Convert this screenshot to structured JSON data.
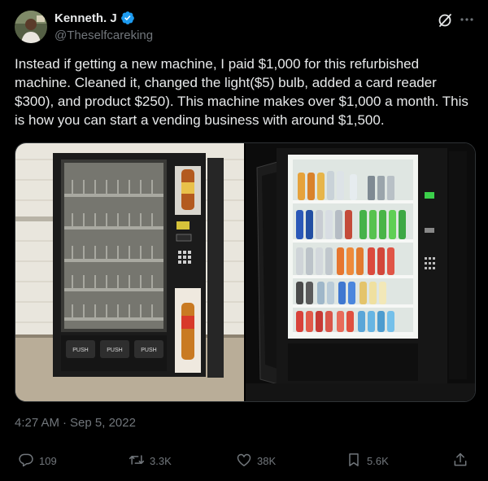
{
  "author": {
    "display_name": "Kenneth. J",
    "handle": "@Theselfcareking",
    "verified": true
  },
  "icons": {
    "avatar": "user-avatar",
    "verified": "verified-badge-icon",
    "grok": "grok-icon",
    "more": "more-icon",
    "reply": "reply-icon",
    "retweet": "retweet-icon",
    "like": "like-icon",
    "bookmark": "bookmark-icon",
    "share": "share-icon"
  },
  "tweet": {
    "text": "Instead if getting a new machine, I paid $1,000 for this refurbished machine. Cleaned it, changed the light($5) bulb, added a card reader $300), and product $250). This machine makes over $1,000 a month. This is how you can start a vending business with around $1,500."
  },
  "media": {
    "left_push_labels": [
      "PUSH",
      "PUSH",
      "PUSH"
    ]
  },
  "meta": {
    "time": "4:27 AM",
    "separator": "·",
    "date": "Sep 5, 2022"
  },
  "stats": {
    "replies": "109",
    "retweets": "3.3K",
    "likes": "38K",
    "bookmarks": "5.6K"
  },
  "colors": {
    "background": "#000000",
    "text": "#e7e9ea",
    "muted": "#71767b",
    "verified": "#1d9bf0"
  }
}
